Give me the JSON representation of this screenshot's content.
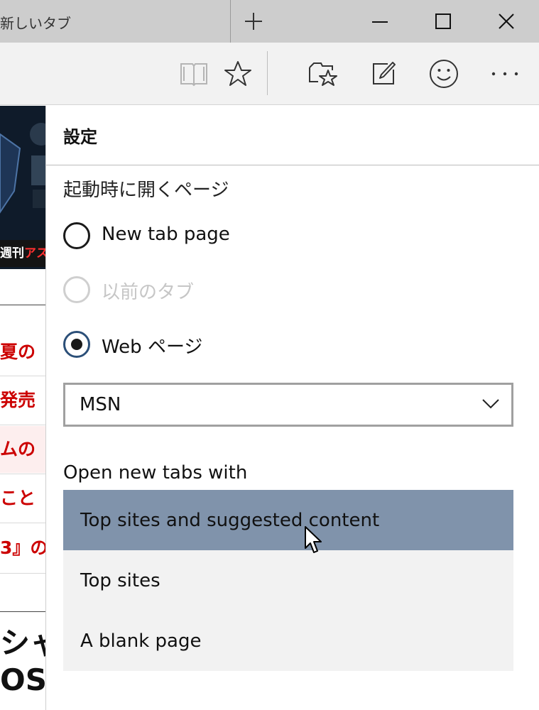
{
  "window": {
    "tab_title": "新しいタブ",
    "new_tab_icon": "plus-icon",
    "controls": [
      "minimize-icon",
      "maximize-icon",
      "close-icon"
    ]
  },
  "toolbar": {
    "icons": [
      "reading-view-icon",
      "favorite-star-icon",
      "hub-icon",
      "web-note-icon",
      "feedback-smiley-icon",
      "more-icon"
    ]
  },
  "background_page": {
    "banner_label_white": "週刊",
    "banner_label_red": "アス",
    "news": [
      "夏の",
      "発売",
      "ムの",
      "こと",
      "3』の"
    ],
    "headline_1": "シャ",
    "headline_2": "OS"
  },
  "settings": {
    "title": "設定",
    "startup_label": "起動時に開くページ",
    "startup_options": [
      {
        "label": "New tab page",
        "state": "unchecked"
      },
      {
        "label": "以前のタブ",
        "state": "disabled"
      },
      {
        "label": "Web ページ",
        "state": "checked"
      }
    ],
    "web_page_select": {
      "value": "MSN"
    },
    "new_tabs_label": "Open new tabs with",
    "new_tabs_options": [
      {
        "label": "Top sites and suggested content",
        "selected": true
      },
      {
        "label": "Top sites",
        "selected": false
      },
      {
        "label": "A blank page",
        "selected": false
      }
    ]
  },
  "colors": {
    "selected_option": "#8093ab",
    "checked_radio_ring": "#2b4f78",
    "news_red": "#cc0000"
  }
}
